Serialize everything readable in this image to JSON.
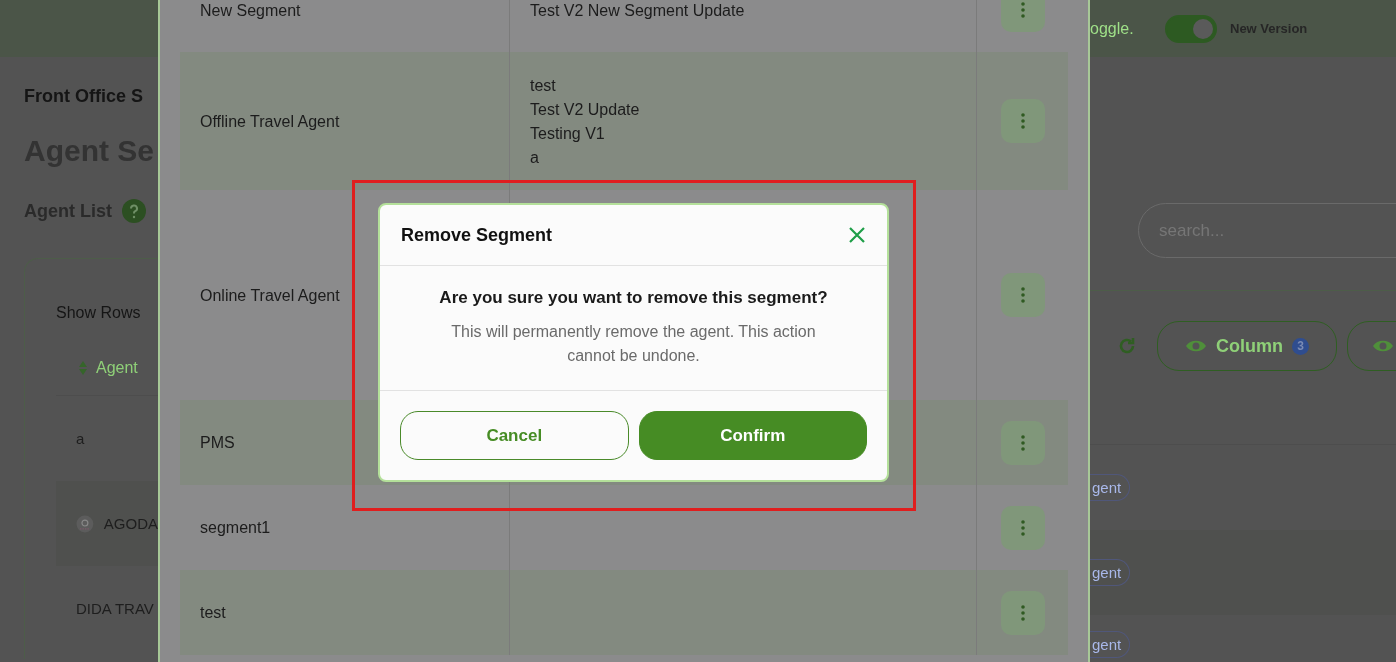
{
  "top_bar": {
    "notice_fragment": "oggle.",
    "version_toggle": {
      "on": true,
      "label": "New Version"
    }
  },
  "page": {
    "breadcrumb": "Front Office S",
    "title": "Agent Se",
    "section_title": "Agent List",
    "search": {
      "placeholder": "search..."
    },
    "show_rows_label": "Show Rows",
    "column_button": {
      "label": "Column",
      "badge": "3"
    },
    "agent_table": {
      "header": "Agent",
      "rows": [
        {
          "name": "a",
          "logo": false,
          "tag": "gent"
        },
        {
          "name": "AGODA",
          "logo": true,
          "tag": "gent"
        },
        {
          "name": "DIDA TRAV",
          "logo": false,
          "tag": "gent"
        }
      ]
    }
  },
  "segments_panel": {
    "rows": [
      {
        "segment": "New Segment",
        "agents": [
          "Test V2 New Segment Update"
        ]
      },
      {
        "segment": "Offline Travel Agent",
        "agents": [
          "test",
          "Test V2 Update",
          "Testing V1",
          "a"
        ]
      },
      {
        "segment": "Online Travel Agent",
        "agents": []
      },
      {
        "segment": "PMS",
        "agents": []
      },
      {
        "segment": "segment1",
        "agents": []
      },
      {
        "segment": "test",
        "agents": []
      }
    ]
  },
  "dialog": {
    "title": "Remove Segment",
    "question": "Are you sure you want to remove this segment?",
    "message": "This will permanently remove the agent. This action cannot be undone.",
    "buttons": [
      {
        "label": "Cancel",
        "kind": "secondary"
      },
      {
        "label": "Confirm",
        "kind": "primary"
      }
    ]
  }
}
